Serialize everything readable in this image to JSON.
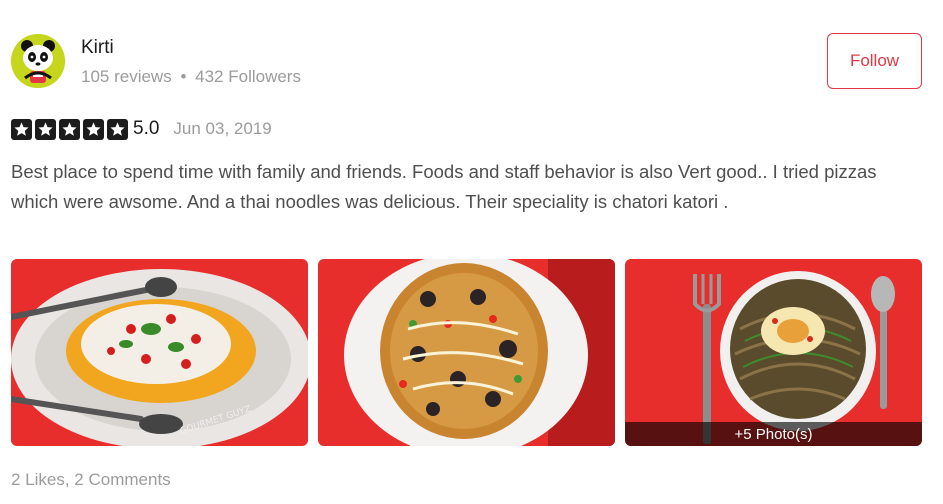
{
  "user": {
    "name": "Kirti",
    "reviews": "105 reviews",
    "separator": "•",
    "followers": "432 Followers",
    "avatar_icon": "panda-icon"
  },
  "follow_button": {
    "label": "Follow"
  },
  "review": {
    "rating_value": "5.0",
    "stars": 5,
    "date": "Jun 03, 2019",
    "text": "Best place to spend time with family and friends. Foods and staff behavior is also Vert good.. I tried pizzas which were awsome. And a thai noodles was delicious. Their speciality is chatori katori ."
  },
  "photos": {
    "watermark": "GOURMET GUYZ",
    "more_label": "+5 Photo(s)"
  },
  "footer": {
    "stats": "2 Likes, 2 Comments"
  },
  "colors": {
    "accent": "#e23744",
    "star": "#1c1c1c",
    "muted": "#9c9c9c",
    "photo_bg": "#e82d2d"
  }
}
